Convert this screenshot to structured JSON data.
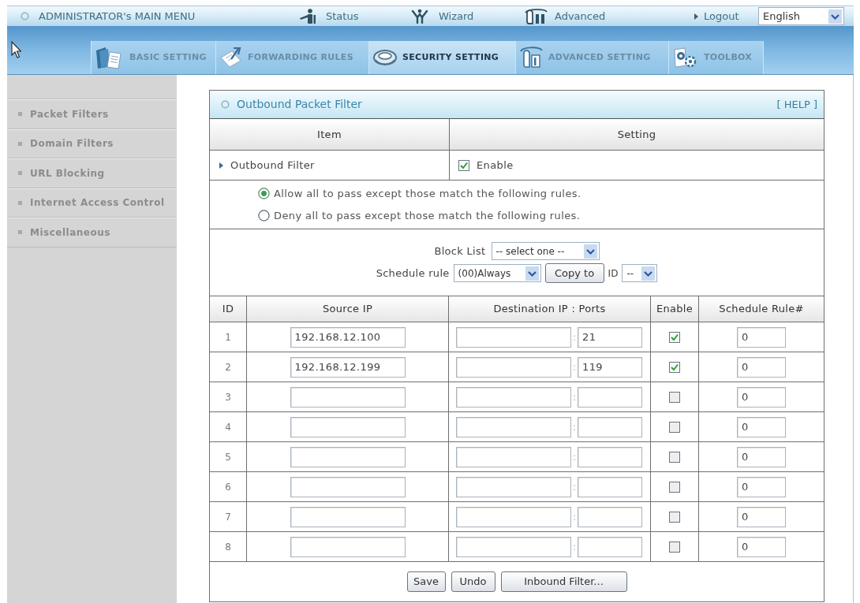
{
  "top_bar": {
    "title": "ADMINISTRATOR's MAIN MENU",
    "links": [
      {
        "label": "Status",
        "kind": "status"
      },
      {
        "label": "Wizard",
        "kind": "wizard"
      },
      {
        "label": "Advanced",
        "kind": "advanced"
      }
    ],
    "logout": "Logout",
    "language": "English"
  },
  "nav_tabs": [
    {
      "label": "BASIC SETTING",
      "kind": "basic",
      "selected": false
    },
    {
      "label": "FORWARDING RULES",
      "kind": "forwarding",
      "selected": false
    },
    {
      "label": "SECURITY SETTING",
      "kind": "security",
      "selected": true
    },
    {
      "label": "ADVANCED SETTING",
      "kind": "advanced",
      "selected": false
    },
    {
      "label": "TOOLBOX",
      "kind": "toolbox",
      "selected": false
    }
  ],
  "sidebar": {
    "items": [
      {
        "label": "Packet Filters"
      },
      {
        "label": "Domain Filters"
      },
      {
        "label": "URL Blocking"
      },
      {
        "label": "Internet Access Control"
      },
      {
        "label": "Miscellaneous"
      }
    ]
  },
  "panel": {
    "title": "Outbound Packet Filter",
    "help": "[ HELP ]",
    "columns": [
      "Item",
      "Setting"
    ],
    "outbound_filter": {
      "label": "Outbound Filter",
      "checked": true,
      "checkbox_label": "Enable"
    },
    "policy_options": [
      {
        "label": "Allow all to pass except those match the following rules.",
        "selected": true
      },
      {
        "label": "Deny all to pass except those match the following rules.",
        "selected": false
      }
    ],
    "block_list": {
      "label": "Block List",
      "value": "-- select one --"
    },
    "schedule": {
      "label": "Schedule rule",
      "value": "(00)Always",
      "copy_button": "Copy to",
      "id_label": "ID",
      "id_value": "--"
    },
    "rules": {
      "columns": [
        "ID",
        "Source IP",
        "Destination IP : Ports",
        "Enable",
        "Schedule Rule#"
      ],
      "rows": [
        {
          "id": "1",
          "source_ip": "192.168.12.100",
          "separator": ":",
          "port": "21",
          "enabled": true,
          "schedule_rule": "0"
        },
        {
          "id": "2",
          "source_ip": "192.168.12.199",
          "separator": ":",
          "port": "119",
          "enabled": true,
          "schedule_rule": "0"
        },
        {
          "id": "3",
          "separator": ":",
          "enabled": false,
          "schedule_rule": "0"
        },
        {
          "id": "4",
          "separator": ":",
          "enabled": false,
          "schedule_rule": "0"
        },
        {
          "id": "5",
          "separator": ":",
          "enabled": false,
          "schedule_rule": "0"
        },
        {
          "id": "6",
          "separator": ":",
          "enabled": false,
          "schedule_rule": "0"
        },
        {
          "id": "7",
          "separator": ":",
          "enabled": false,
          "schedule_rule": "0"
        },
        {
          "id": "8",
          "separator": ":",
          "enabled": false,
          "schedule_rule": "0"
        }
      ]
    },
    "buttons": [
      "Save",
      "Undo",
      "Inbound Filter..."
    ]
  }
}
